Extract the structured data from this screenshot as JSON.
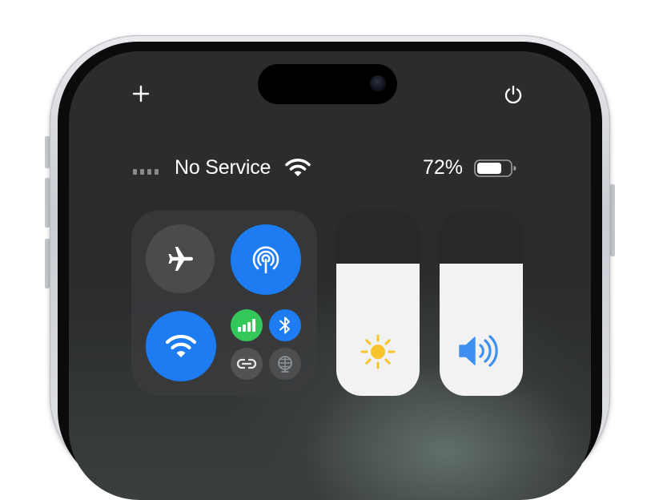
{
  "status_bar": {
    "carrier": "No Service",
    "battery_percent": "72%",
    "battery_level": 0.72,
    "signal_bars": 4
  },
  "top_controls": {
    "add_icon": "plus-icon",
    "power_icon": "power-icon"
  },
  "connectivity": {
    "airplane_mode": {
      "icon": "airplane-icon",
      "on": false
    },
    "airdrop": {
      "icon": "airdrop-icon",
      "on": true
    },
    "wifi": {
      "icon": "wifi-icon",
      "on": true
    },
    "cellular": {
      "icon": "cellular-icon",
      "on": true
    },
    "bluetooth": {
      "icon": "bluetooth-icon",
      "on": true
    },
    "personal_hotspot": {
      "icon": "link-icon",
      "on": false
    },
    "vpn": {
      "icon": "globe-icon",
      "on": false
    }
  },
  "sliders": {
    "brightness": {
      "icon": "sun-icon",
      "level": 0.71
    },
    "volume": {
      "icon": "speaker-icon",
      "level": 0.71
    }
  },
  "colors": {
    "accent_blue": "#1d7cf2",
    "cellular_green": "#34c759",
    "sun_yellow": "#f7c52b",
    "speaker_blue": "#3e91f0"
  }
}
